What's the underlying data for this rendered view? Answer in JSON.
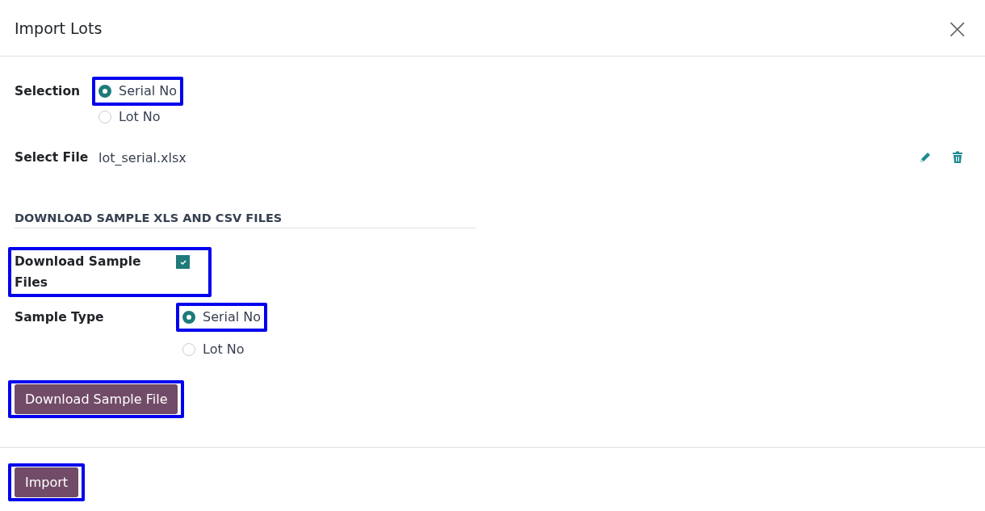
{
  "dialog": {
    "title": "Import Lots",
    "close": "×"
  },
  "selection": {
    "label": "Selection",
    "options": [
      {
        "label": "Serial No",
        "selected": true,
        "highlighted": true
      },
      {
        "label": "Lot No",
        "selected": false,
        "highlighted": false
      }
    ]
  },
  "file": {
    "label": "Select File",
    "value": "lot_serial.xlsx"
  },
  "section": {
    "title": "DOWNLOAD SAMPLE XLS AND CSV FILES"
  },
  "download_sample": {
    "label": "Download Sample Files",
    "checked": true,
    "highlighted": true
  },
  "sample_type": {
    "label": "Sample Type",
    "options": [
      {
        "label": "Serial No",
        "selected": true,
        "highlighted": true
      },
      {
        "label": "Lot No",
        "selected": false,
        "highlighted": false
      }
    ]
  },
  "download_button": {
    "label": "Download Sample File",
    "highlighted": true
  },
  "footer": {
    "buttons": [
      {
        "label": "Import",
        "highlighted": true
      }
    ]
  }
}
